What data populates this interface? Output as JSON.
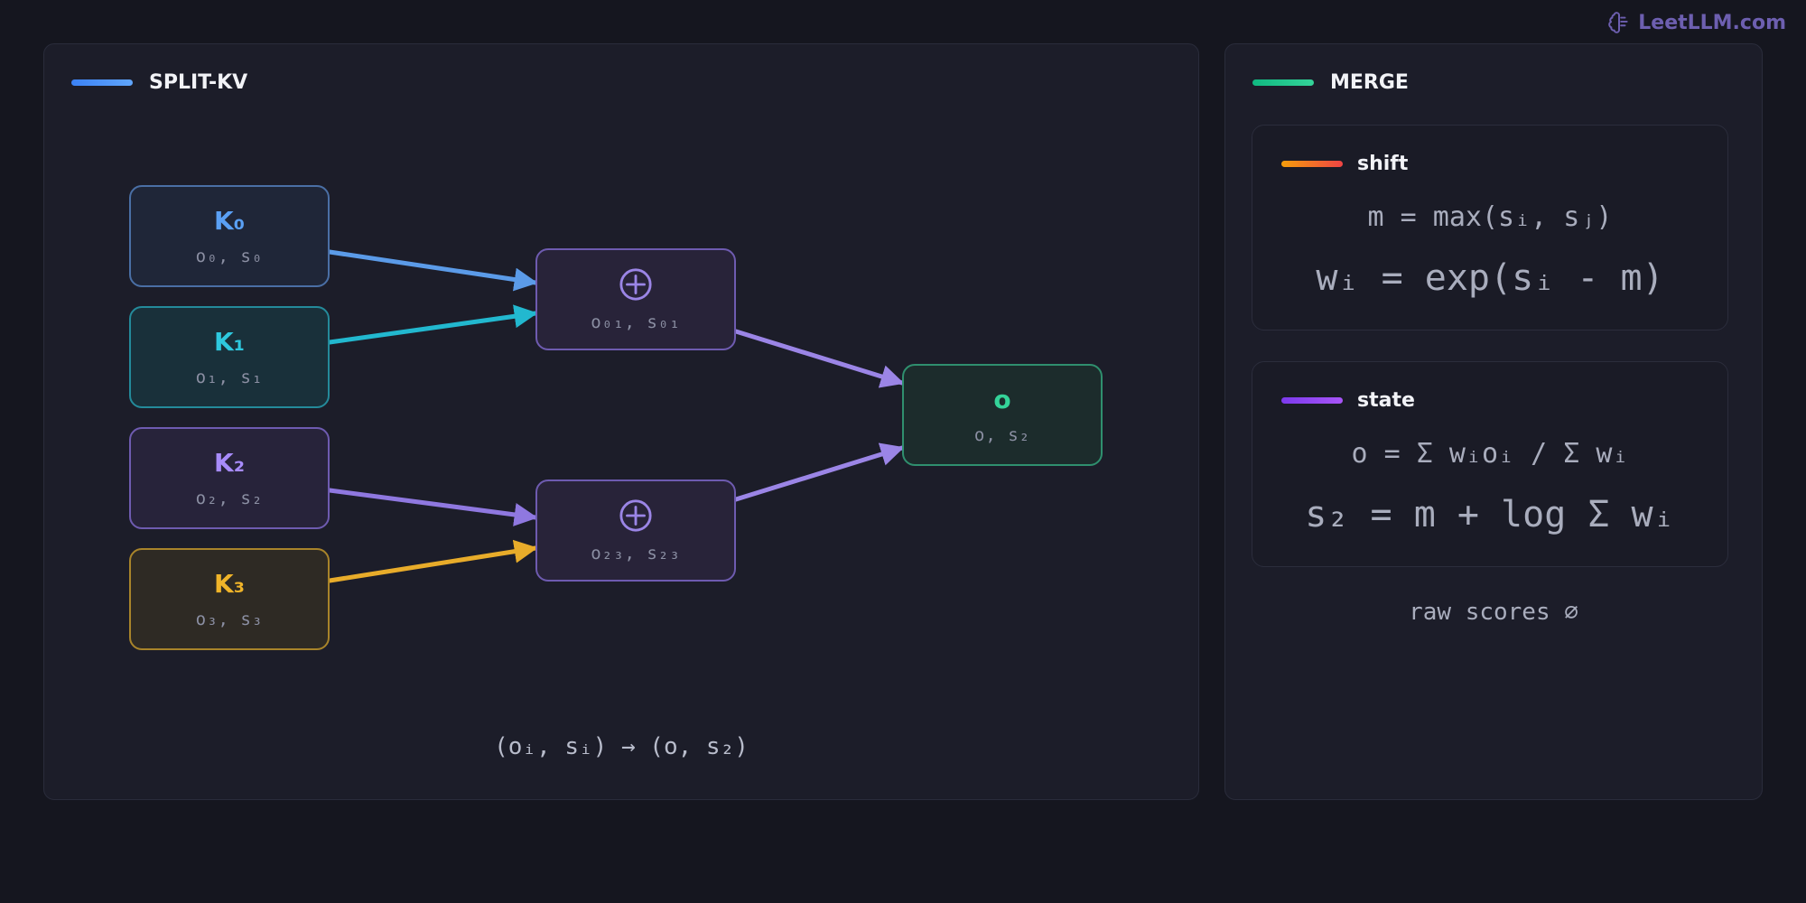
{
  "brand": {
    "name": "LeetLLM.com",
    "icon": "brain-icon"
  },
  "split_kv": {
    "title": "SPLIT-KV",
    "accent": "#3b82f6",
    "inputs": [
      {
        "label": "K₀",
        "sub": "o₀, s₀",
        "text_color": "#5aa0f5",
        "border": "#4a6fa5",
        "fill": "#1f2638",
        "edge": "#5b9be8"
      },
      {
        "label": "K₁",
        "sub": "o₁, s₁",
        "text_color": "#2ec8de",
        "border": "#248a9a",
        "fill": "#19303a",
        "edge": "#22b8cf"
      },
      {
        "label": "K₂",
        "sub": "o₂, s₂",
        "text_color": "#a78bfa",
        "border": "#6e5bb0",
        "fill": "#27233a",
        "edge": "#8f78e0"
      },
      {
        "label": "K₃",
        "sub": "o₃, s₃",
        "text_color": "#f0b429",
        "border": "#a8842a",
        "fill": "#2e2a24",
        "edge": "#e8ac2a"
      }
    ],
    "merges": [
      {
        "sub": "o₀₁, s₀₁",
        "symbol": "circled-plus-icon"
      },
      {
        "sub": "o₂₃, s₂₃",
        "symbol": "circled-plus-icon"
      }
    ],
    "output": {
      "label": "o",
      "sub": "o, s₂",
      "text_color": "#34d399",
      "border": "#2f8f6e",
      "fill": "#1c2c2c"
    },
    "caption": "(oᵢ, sᵢ) → (o, s₂)"
  },
  "merge": {
    "title": "MERGE",
    "accent": "#10b981",
    "shift": {
      "title": "shift",
      "formula1": "m = max(sᵢ, sⱼ)",
      "formula2": "wᵢ = exp(sᵢ - m)"
    },
    "state": {
      "title": "state",
      "formula1": "o = Σ wᵢoᵢ / Σ wᵢ",
      "formula2": "s₂ = m + log Σ wᵢ"
    },
    "note": "raw scores ∅"
  },
  "colors": {
    "merge_purple": "#9b85e6",
    "output_green": "#34d399"
  }
}
